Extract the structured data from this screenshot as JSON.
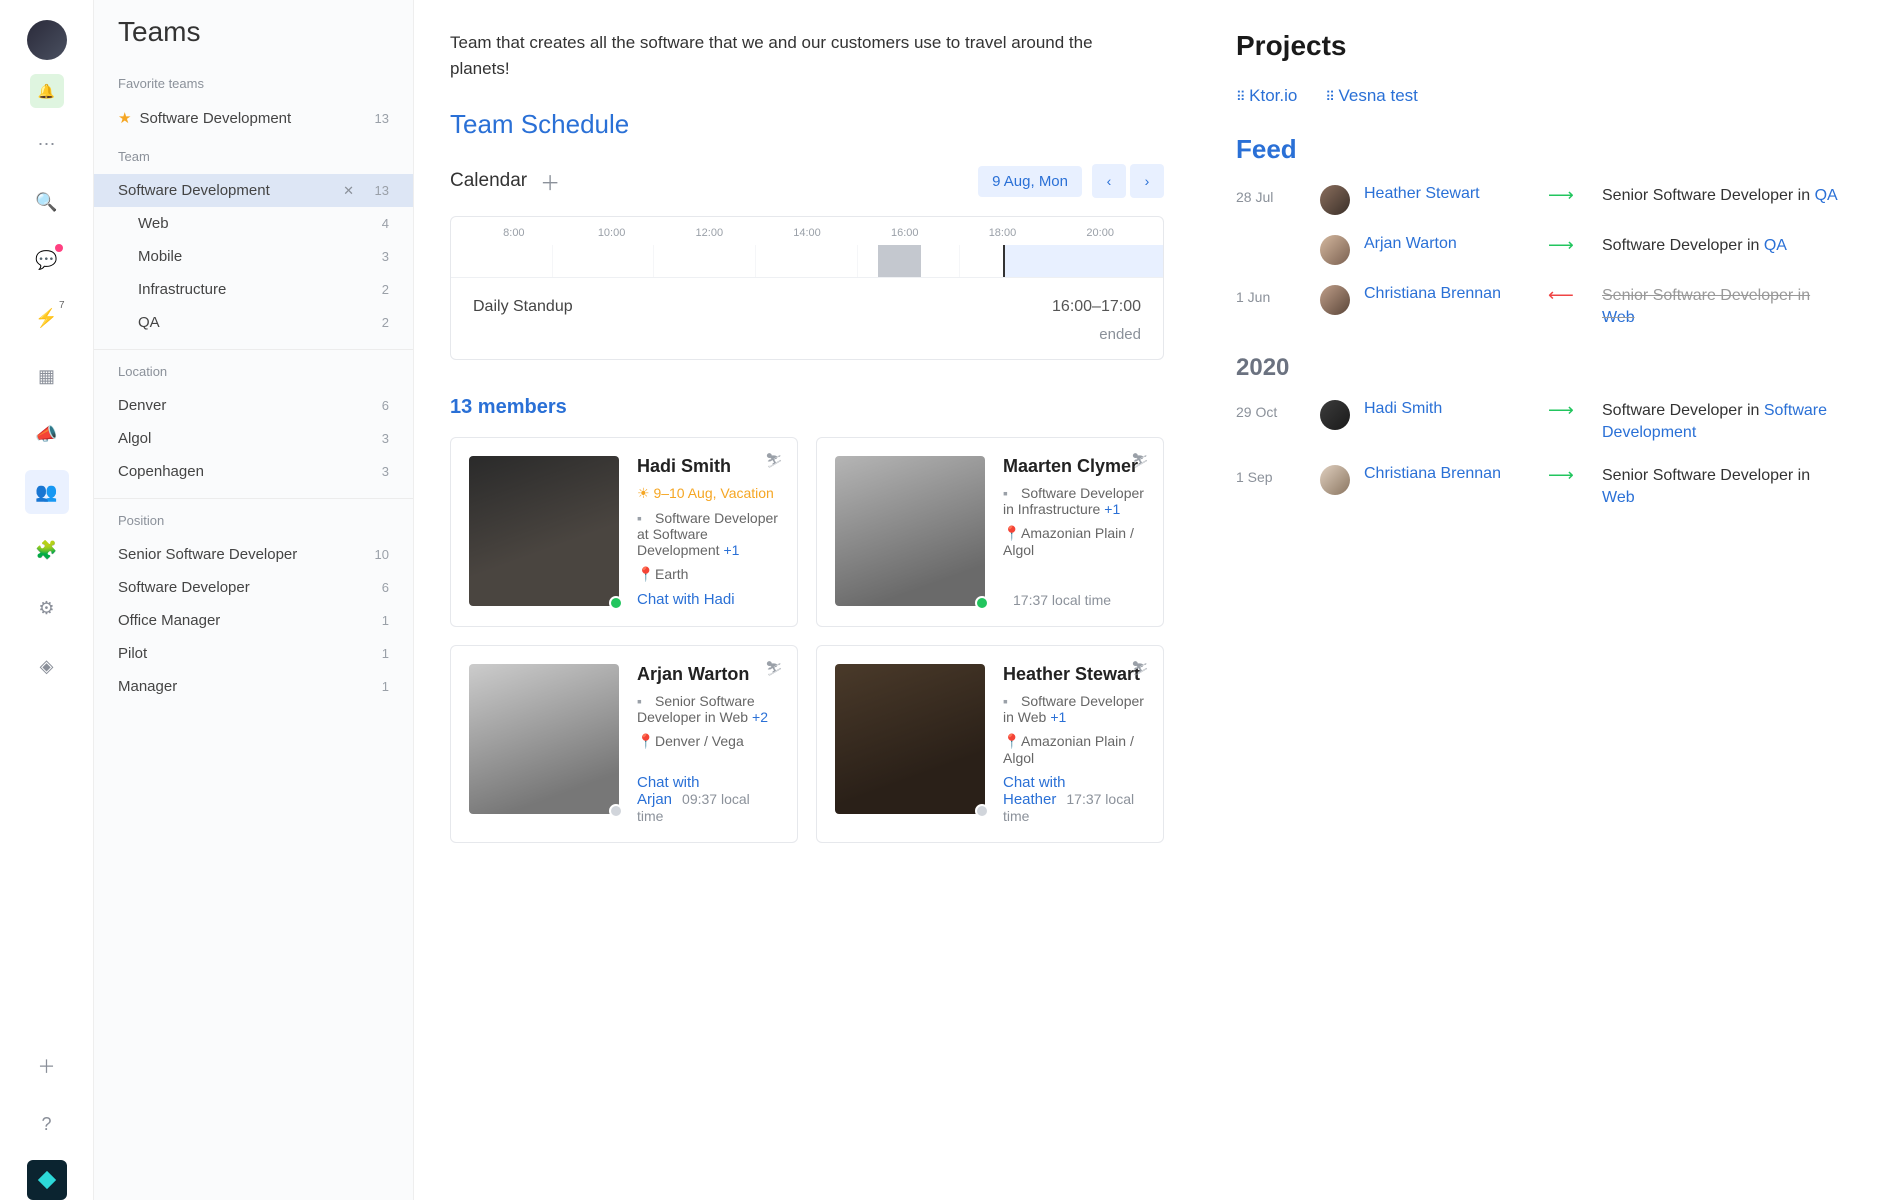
{
  "rail": {
    "avatar_initials": ""
  },
  "sidebar": {
    "title": "Teams",
    "fav_header": "Favorite teams",
    "fav": {
      "name": "Software Development",
      "count": "13"
    },
    "team_header": "Team",
    "active": {
      "name": "Software Development",
      "count": "13"
    },
    "subs": [
      {
        "name": "Web",
        "count": "4"
      },
      {
        "name": "Mobile",
        "count": "3"
      },
      {
        "name": "Infrastructure",
        "count": "2"
      },
      {
        "name": "QA",
        "count": "2"
      }
    ],
    "loc_header": "Location",
    "locations": [
      {
        "name": "Denver",
        "count": "6"
      },
      {
        "name": "Algol",
        "count": "3"
      },
      {
        "name": "Copenhagen",
        "count": "3"
      }
    ],
    "pos_header": "Position",
    "positions": [
      {
        "name": "Senior Software Developer",
        "count": "10"
      },
      {
        "name": "Software Developer",
        "count": "6"
      },
      {
        "name": "Office Manager",
        "count": "1"
      },
      {
        "name": "Pilot",
        "count": "1"
      },
      {
        "name": "Manager",
        "count": "1"
      }
    ]
  },
  "center": {
    "description": "Team that creates all the software that we and our customers use to travel around the planets!",
    "schedule_heading": "Team Schedule",
    "calendar_label": "Calendar",
    "date_pill": "9 Aug, Mon",
    "hours": [
      "8:00",
      "10:00",
      "12:00",
      "14:00",
      "16:00",
      "18:00",
      "20:00"
    ],
    "event": {
      "name": "Daily Standup",
      "time": "16:00–17:00",
      "status": "ended"
    },
    "members_heading": "13 members"
  },
  "members": [
    {
      "name": "Hadi Smith",
      "vacation": "9–10 Aug, Vacation",
      "role": "Software Developer at Software Development",
      "plus": "+1",
      "location": "Earth",
      "chat": "Chat with Hadi",
      "localtime": "",
      "presence": "online",
      "img": "portrait1"
    },
    {
      "name": "Maarten Clymer",
      "vacation": "",
      "role": "Software Developer in Infrastructure",
      "plus": "+1",
      "location": "Amazonian Plain / Algol",
      "chat": "",
      "localtime": "17:37 local time",
      "presence": "online",
      "img": "portrait2"
    },
    {
      "name": "Arjan Warton",
      "vacation": "",
      "role": "Senior Software Developer in Web",
      "plus": "+2",
      "location": "Denver / Vega",
      "chat": "Chat with Arjan",
      "localtime": "09:37 local time",
      "presence": "offline",
      "img": "portrait3"
    },
    {
      "name": "Heather Stewart",
      "vacation": "",
      "role": "Software Developer in Web",
      "plus": "+1",
      "location": "Amazonian Plain / Algol",
      "chat": "Chat with Heather",
      "localtime": "17:37 local time",
      "presence": "offline",
      "img": "portrait4"
    }
  ],
  "right": {
    "projects_heading": "Projects",
    "proj1": "Ktor.io",
    "proj2": "Vesna test",
    "feed_heading": "Feed",
    "year": "2020",
    "feed": [
      {
        "date": "28 Jul",
        "name": "Heather Stewart",
        "arrow": "green",
        "text_pre": "Senior Software Developer in ",
        "link": "QA",
        "struck": false,
        "av": "av1"
      },
      {
        "date": "",
        "name": "Arjan Warton",
        "arrow": "green",
        "text_pre": "Software Developer in ",
        "link": "QA",
        "struck": false,
        "av": "av2"
      },
      {
        "date": "1 Jun",
        "name": "Christiana Brennan",
        "arrow": "red",
        "text_pre": "Senior Software Developer in ",
        "link": "Web",
        "struck": true,
        "av": "av3"
      }
    ],
    "feed2": [
      {
        "date": "29 Oct",
        "name": "Hadi Smith",
        "arrow": "green",
        "text_pre": "Software Developer in ",
        "link": "Software Development",
        "struck": false,
        "av": "av4"
      },
      {
        "date": "1 Sep",
        "name": "Christiana Brennan",
        "arrow": "green",
        "text_pre": "Senior Software Developer in ",
        "link": "Web",
        "struck": false,
        "av": "av5"
      }
    ]
  }
}
